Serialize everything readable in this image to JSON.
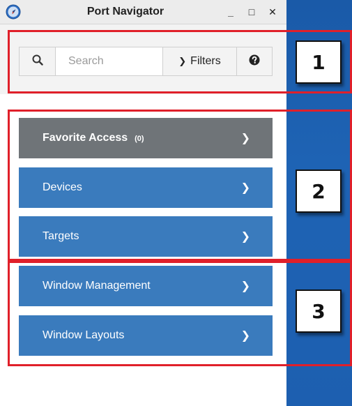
{
  "window": {
    "title": "Port Navigator",
    "controls": {
      "minimize": "_",
      "maximize": "□",
      "close": "✕"
    }
  },
  "toolbar": {
    "search_placeholder": "Search",
    "filters_label": "Filters",
    "filters_arrow": "❯",
    "help_icon": "help-circle"
  },
  "nav": {
    "favorites": {
      "label": "Favorite Access",
      "count": "(0)"
    },
    "devices": {
      "label": "Devices"
    },
    "targets": {
      "label": "Targets"
    },
    "window_management": {
      "label": "Window Management"
    },
    "window_layouts": {
      "label": "Window Layouts"
    },
    "chevron": "❯"
  },
  "callouts": [
    "1",
    "2",
    "3"
  ],
  "colors": {
    "nav_blue": "#3a7bbd",
    "nav_grey": "#6f7478",
    "callout_red": "#e0202a",
    "background_blue": "#1e63b4"
  }
}
